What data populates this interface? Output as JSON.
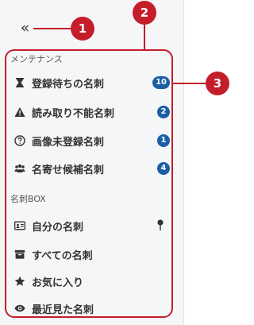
{
  "sidebar": {
    "collapse_glyph": "«",
    "maintenance": {
      "header": "メンテナンス",
      "items": [
        {
          "label": "登録待ちの名刺",
          "badge": "10"
        },
        {
          "label": "読み取り不能名刺",
          "badge": "2"
        },
        {
          "label": "画像未登録名刺",
          "badge": "1"
        },
        {
          "label": "名寄せ候補名刺",
          "badge": "4"
        }
      ]
    },
    "card_box": {
      "header": "名刺BOX",
      "items": [
        {
          "label": "自分の名刺"
        },
        {
          "label": "すべての名刺"
        },
        {
          "label": "お気に入り"
        },
        {
          "label": "最近見た名刺"
        }
      ]
    }
  },
  "callouts": [
    "1",
    "2",
    "3"
  ],
  "colors": {
    "accent_red": "#c41e2a",
    "badge_blue": "#1a5fa5",
    "sidebar_bg": "#f5f6f8"
  },
  "icons": [
    "collapse-icon",
    "hourglass-icon",
    "warning-icon",
    "question-icon",
    "users-icon",
    "id-card-icon",
    "archive-icon",
    "star-icon",
    "eye-icon",
    "pin-icon"
  ]
}
